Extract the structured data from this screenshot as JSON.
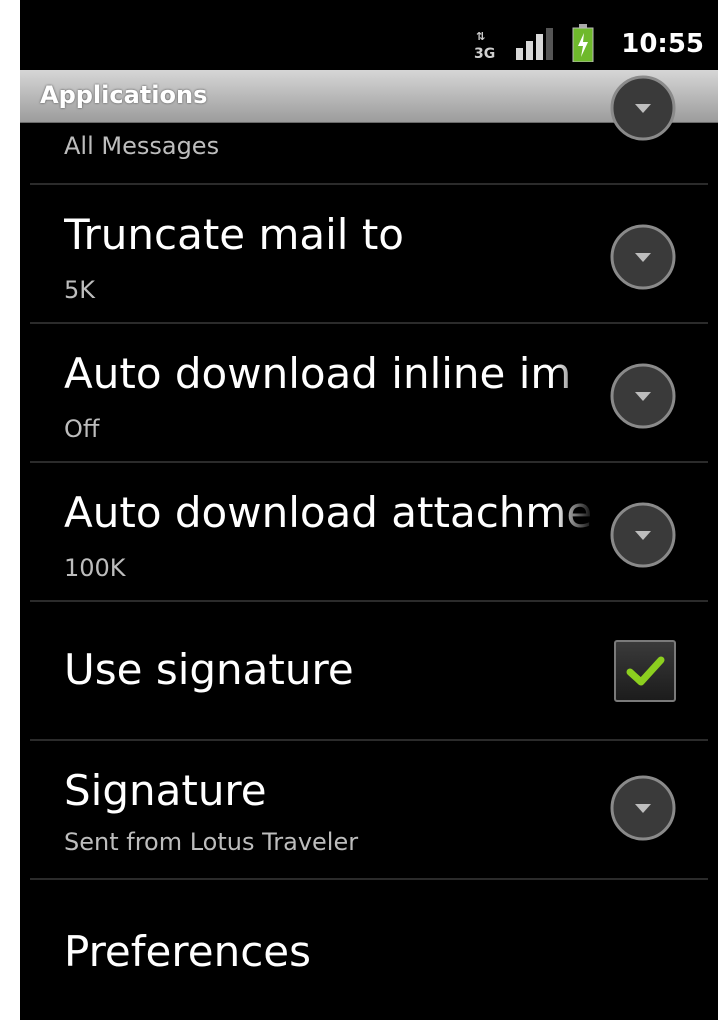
{
  "status_bar": {
    "time": "10:55",
    "network_icon": "3g-data-icon",
    "signal_icon": "signal-strength-icon",
    "battery_icon": "battery-charging-icon"
  },
  "title_bar": {
    "title": "Applications"
  },
  "settings": [
    {
      "title": "",
      "summary": "All Messages",
      "control": "dropdown"
    },
    {
      "title": "Truncate mail to",
      "summary": "5K",
      "control": "dropdown"
    },
    {
      "title": "Auto download inline im",
      "summary": "Off",
      "control": "dropdown"
    },
    {
      "title": "Auto download attachme",
      "summary": "100K",
      "control": "dropdown"
    },
    {
      "title": "Use signature",
      "summary": "",
      "control": "checkbox",
      "checked": true
    },
    {
      "title": "Signature",
      "summary": "Sent from Lotus Traveler",
      "control": "dropdown"
    },
    {
      "title": "Preferences",
      "summary": "",
      "control": "none"
    }
  ],
  "colors": {
    "checkmark": "#8ccf1f",
    "title_bar": "#b5b5b5",
    "background": "#000000"
  }
}
